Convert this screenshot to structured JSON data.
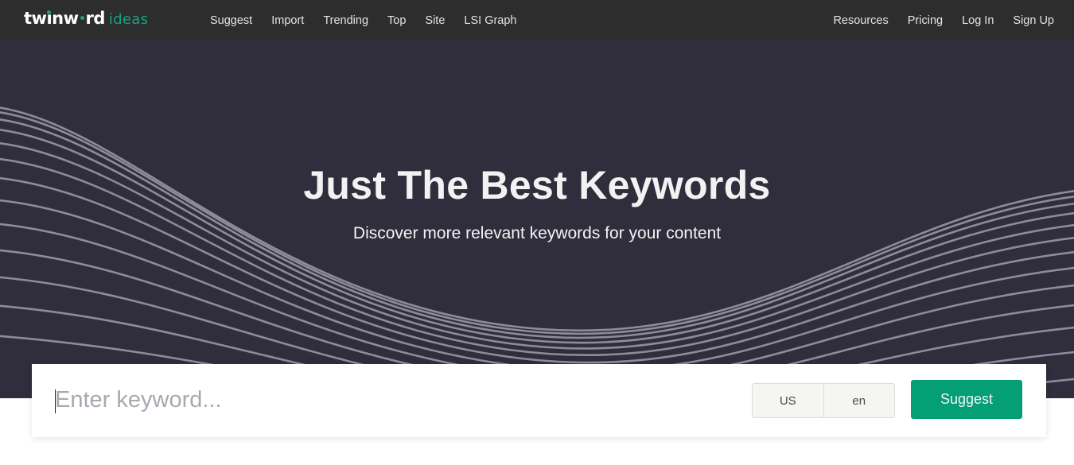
{
  "nav": {
    "logo": {
      "brand_before_i": "tw",
      "brand_i": "ı",
      "brand_mid": "nw",
      "brand_after_dot": "rd",
      "product": "ideas"
    },
    "left_links": [
      {
        "label": "Suggest"
      },
      {
        "label": "Import"
      },
      {
        "label": "Trending"
      },
      {
        "label": "Top"
      },
      {
        "label": "Site"
      },
      {
        "label": "LSI Graph"
      }
    ],
    "right_links": [
      {
        "label": "Resources"
      },
      {
        "label": "Pricing"
      },
      {
        "label": "Log In"
      },
      {
        "label": "Sign Up"
      }
    ]
  },
  "hero": {
    "title": "Just The Best Keywords",
    "subtitle": "Discover more relevant keywords for your content"
  },
  "search": {
    "input_value": "",
    "placeholder": "Enter keyword...",
    "country": "US",
    "language": "en",
    "submit_label": "Suggest"
  },
  "colors": {
    "nav_bg": "#2d2d2d",
    "hero_bg": "#302d3c",
    "wave_line": "#8e8c9a",
    "accent_green": "#049f75",
    "logo_green": "#14a37f"
  }
}
